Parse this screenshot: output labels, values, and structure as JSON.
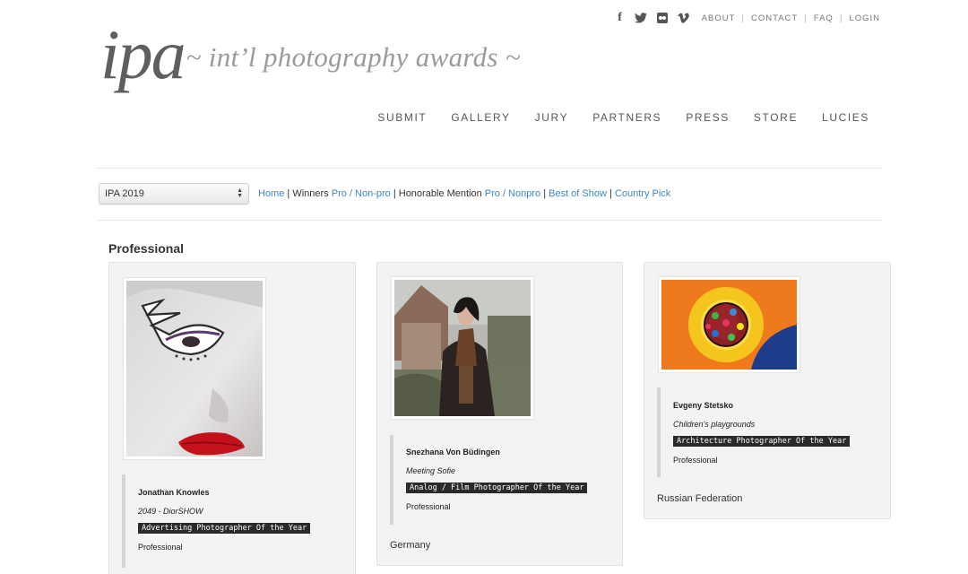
{
  "social": [
    "facebook-icon",
    "twitter-icon",
    "flickr-icon",
    "vimeo-icon"
  ],
  "util_links": [
    "ABOUT",
    "CONTACT",
    "FAQ",
    "LOGIN"
  ],
  "logo": {
    "mark": "ipa",
    "tagline": "~ int’l photography awards ~"
  },
  "nav": [
    "SUBMIT",
    "GALLERY",
    "JURY",
    "PARTNERS",
    "PRESS",
    "STORE",
    "LUCIES"
  ],
  "filter": {
    "year": "IPA 2019",
    "home": "Home",
    "sep": "|",
    "winners": "Winners",
    "pro_nonpro_1": "Pro / Non-pro",
    "honorable": "Honorable Mention",
    "pro_nonpro_2": "Pro / Nonpro",
    "best_of_show": "Best of Show",
    "country_pick": "Country Pick"
  },
  "section_title": "Professional",
  "cards": [
    {
      "name": "Jonathan Knowles",
      "title": "2049 - DiorSHOW",
      "award": "Advertising Photographer Of the Year",
      "category": "Professional",
      "country": ""
    },
    {
      "name": "Snezhana Von Büdingen",
      "title": "Meeting Sofie",
      "award": "Analog / Film Photographer Of the Year",
      "category": "Professional",
      "country": "Germany"
    },
    {
      "name": "Evgeny Stetsko",
      "title": "Children's playgrounds",
      "award": "Architecture Photographer Of the Year",
      "category": "Professional",
      "country": "Russian Federation"
    }
  ],
  "colors": {
    "link": "#3d86c6",
    "award_bg": "#2a2a2a",
    "card_bg": "#f3f3f3"
  }
}
